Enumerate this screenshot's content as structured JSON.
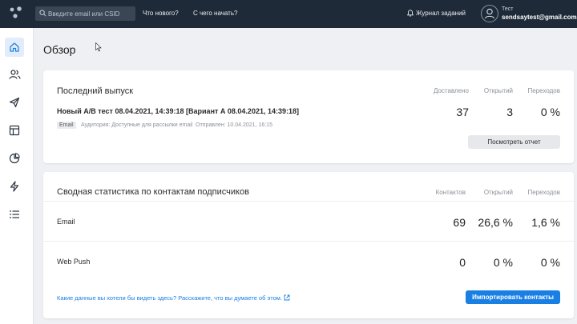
{
  "header": {
    "search_placeholder": "Введите email или CSID",
    "nav_whats_new": "Что нового?",
    "nav_getting_started": "С чего начать?",
    "tasks_label": "Журнал заданий",
    "user_name": "Тест",
    "user_email": "sendsaytest@gmail.com"
  },
  "sidebar": {
    "items": [
      {
        "icon": "home-icon",
        "active": true
      },
      {
        "icon": "users-icon",
        "active": false
      },
      {
        "icon": "send-icon",
        "active": false
      },
      {
        "icon": "layout-icon",
        "active": false
      },
      {
        "icon": "pie-chart-icon",
        "active": false
      },
      {
        "icon": "lightning-icon",
        "active": false
      },
      {
        "icon": "list-icon",
        "active": false
      }
    ]
  },
  "page": {
    "title": "Обзор"
  },
  "last_release": {
    "title": "Последний выпуск",
    "col_delivered": "Доставлено",
    "col_opened": "Открытий",
    "col_clicks": "Переходов",
    "release_name": "Новый А/В тест 08.04.2021, 14:39:18 [Вариант А 08.04.2021, 14:39:18]",
    "tag": "Email",
    "audience": "Аудитория: Доступные для рассылки email",
    "sent": "Отправлен: 10.04.2021, 16:15",
    "delivered": "37",
    "opened": "3",
    "clicks": "0 %",
    "report_button": "Посмотреть отчет"
  },
  "contacts_stats": {
    "title": "Сводная статистика по контактам подписчиков",
    "col_contacts": "Контактов",
    "col_opened": "Открытий",
    "col_clicks": "Переходов",
    "rows": [
      {
        "label": "Email",
        "contacts": "69",
        "opened": "26,6 %",
        "clicks": "1,6 %"
      },
      {
        "label": "Web Push",
        "contacts": "0",
        "opened": "0 %",
        "clicks": "0 %"
      }
    ],
    "feedback_link": "Какие данные вы хотели бы видеть здесь? Расскажите, что вы думаете об этом.",
    "import_button": "Импортировать контакты"
  },
  "colors": {
    "topbar": "#1f2a38",
    "accent": "#1a7fe3",
    "background": "#eef0f3"
  }
}
